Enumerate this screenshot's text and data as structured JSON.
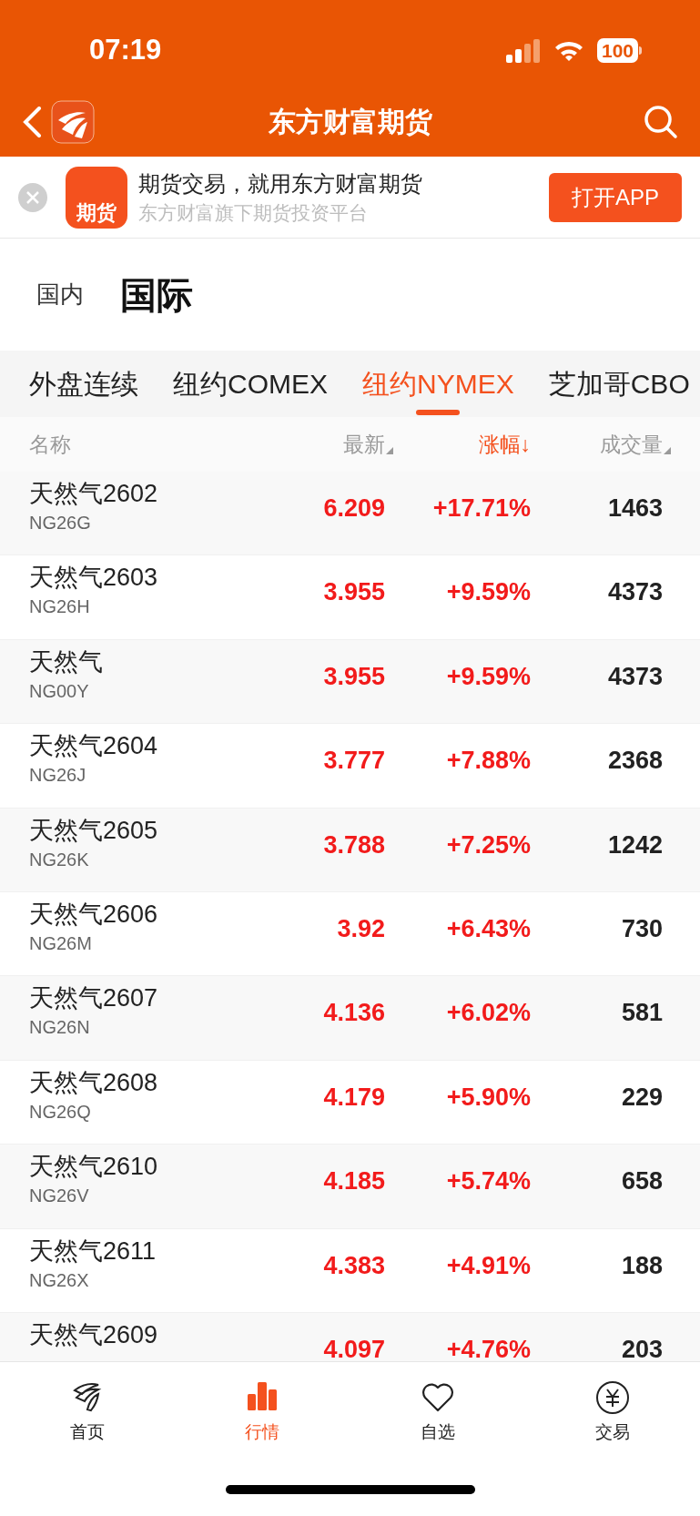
{
  "status_bar": {
    "time": "07:19",
    "battery": "100"
  },
  "nav": {
    "title": "东方财富期货"
  },
  "banner": {
    "app_icon_label": "期货",
    "headline": "期货交易，就用东方财富期货",
    "subline": "东方财富旗下期货投资平台",
    "button": "打开APP"
  },
  "region_tabs": [
    {
      "label": "国内",
      "selected": false
    },
    {
      "label": "国际",
      "selected": true
    }
  ],
  "category_tabs": [
    {
      "label": "外盘连续",
      "selected": false
    },
    {
      "label": "纽约COMEX",
      "selected": false
    },
    {
      "label": "纽约NYMEX",
      "selected": true
    },
    {
      "label": "芝加哥CBO",
      "selected": false
    }
  ],
  "table": {
    "columns": [
      {
        "kind": "plain",
        "label": "名称",
        "sorted": false
      },
      {
        "kind": "sortable",
        "label": "最新",
        "sorted": false
      },
      {
        "kind": "sortable",
        "label": "涨幅↓",
        "sorted": true
      },
      {
        "kind": "sortable",
        "label": "成交量",
        "sorted": false
      }
    ],
    "rows": [
      {
        "name": "天然气2602",
        "code": "NG26G",
        "price": "6.209",
        "change": "+17.71%",
        "volume": "1463"
      },
      {
        "name": "天然气2603",
        "code": "NG26H",
        "price": "3.955",
        "change": "+9.59%",
        "volume": "4373"
      },
      {
        "name": "天然气",
        "code": "NG00Y",
        "price": "3.955",
        "change": "+9.59%",
        "volume": "4373"
      },
      {
        "name": "天然气2604",
        "code": "NG26J",
        "price": "3.777",
        "change": "+7.88%",
        "volume": "2368"
      },
      {
        "name": "天然气2605",
        "code": "NG26K",
        "price": "3.788",
        "change": "+7.25%",
        "volume": "1242"
      },
      {
        "name": "天然气2606",
        "code": "NG26M",
        "price": "3.92",
        "change": "+6.43%",
        "volume": "730"
      },
      {
        "name": "天然气2607",
        "code": "NG26N",
        "price": "4.136",
        "change": "+6.02%",
        "volume": "581"
      },
      {
        "name": "天然气2608",
        "code": "NG26Q",
        "price": "4.179",
        "change": "+5.90%",
        "volume": "229"
      },
      {
        "name": "天然气2610",
        "code": "NG26V",
        "price": "4.185",
        "change": "+5.74%",
        "volume": "658"
      },
      {
        "name": "天然气2611",
        "code": "NG26X",
        "price": "4.383",
        "change": "+4.91%",
        "volume": "188"
      },
      {
        "name": "天然气2609",
        "price": "4.097",
        "change": "+4.76%",
        "volume": "203"
      }
    ]
  },
  "bottom_tabs": [
    {
      "kind": "home",
      "label": "首页",
      "selected": false
    },
    {
      "kind": "market",
      "label": "行情",
      "selected": true
    },
    {
      "kind": "watchlist",
      "label": "自选",
      "selected": false
    },
    {
      "kind": "trade",
      "label": "交易",
      "selected": false
    }
  ]
}
